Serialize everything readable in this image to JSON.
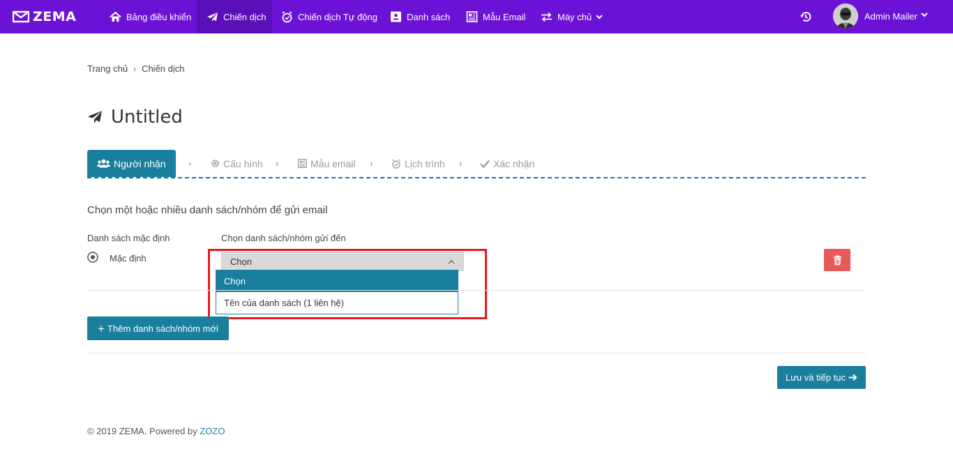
{
  "brand": {
    "name": "ZEMA"
  },
  "nav": {
    "items": [
      {
        "label": "Bảng điều khiển",
        "icon": "home-icon"
      },
      {
        "label": "Chiến dịch",
        "icon": "paper-plane-icon",
        "active": true
      },
      {
        "label": "Chiến dịch Tự động",
        "icon": "alarm-clock-icon"
      },
      {
        "label": "Danh sách",
        "icon": "contact-book-icon"
      },
      {
        "label": "Mẫu Email",
        "icon": "newspaper-icon"
      },
      {
        "label": "Máy chủ",
        "icon": "exchange-icon",
        "has_dropdown": true
      }
    ],
    "user": {
      "name": "Admin Mailer"
    },
    "colors": {
      "bar": "#6c12d6",
      "active": "#5a0fb8"
    }
  },
  "breadcrumb": {
    "home": "Trang chủ",
    "current": "Chiến dịch"
  },
  "page": {
    "title": "Untitled"
  },
  "steps": [
    {
      "label": "Người nhận",
      "icon": "users-icon",
      "active": true
    },
    {
      "label": "Cấu hình",
      "icon": "gear-icon"
    },
    {
      "label": "Mẫu email",
      "icon": "template-icon"
    },
    {
      "label": "Lịch trình",
      "icon": "alarm-clock-icon"
    },
    {
      "label": "Xác nhận",
      "icon": "check-icon"
    }
  ],
  "form": {
    "instruction": "Chọn một hoặc nhiều danh sách/nhóm để gửi email",
    "default_list_label": "Danh sách mặc định",
    "select_list_label": "Chọn danh sách/nhóm gửi đến",
    "radio_label": "Mặc định",
    "select_value": "Chọn",
    "dropdown_options": [
      "Chọn",
      "Tên của danh sách (1 liên hệ)"
    ],
    "add_button": "Thêm danh sách/nhóm mới",
    "save_button": "Lưu và tiếp tục"
  },
  "footer": {
    "text": "© 2019 ZEMA. Powered by",
    "link": "ZOZO"
  },
  "colors": {
    "accent": "#1a7f9c",
    "danger": "#e85a57",
    "highlight": "#e8191c"
  }
}
